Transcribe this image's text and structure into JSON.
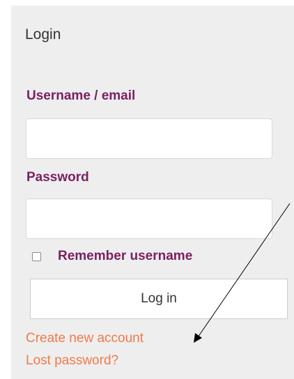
{
  "login": {
    "title": "Login",
    "username_label": "Username / email",
    "username_value": "",
    "password_label": "Password",
    "password_value": "",
    "remember_label": "Remember username",
    "remember_checked": false,
    "login_button": "Log in",
    "create_account_link": "Create new account",
    "lost_password_link": "Lost password?"
  },
  "colors": {
    "panel_bg": "#eeeeee",
    "label": "#7a1f63",
    "link": "#f07a4a"
  }
}
